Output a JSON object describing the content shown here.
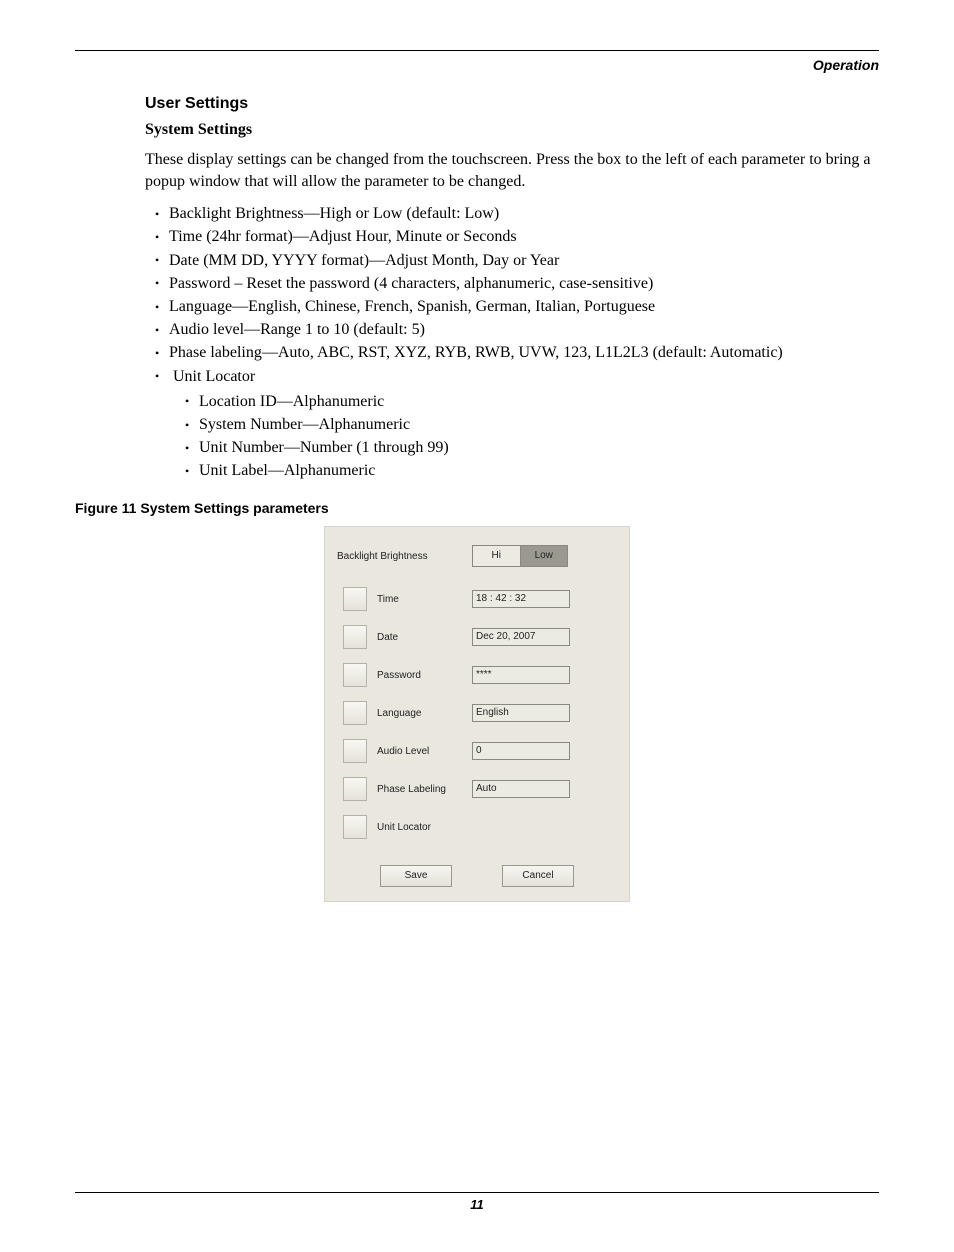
{
  "header": {
    "section": "Operation"
  },
  "headings": {
    "user_settings": "User Settings",
    "system_settings": "System Settings"
  },
  "intro": " These display settings can be changed from the touchscreen. Press the box to the left of each parameter to bring a popup window that will allow the parameter to be changed.",
  "bullets": [
    "Backlight Brightness—High or Low (default: Low)",
    "Time (24hr format)—Adjust Hour, Minute or Seconds",
    "Date (MM DD, YYYY format)—Adjust Month, Day or Year",
    "Password – Reset the password (4 characters, alphanumeric, case-sensitive)",
    "Language—English, Chinese, French, Spanish, German, Italian, Portuguese",
    "Audio level—Range 1 to 10 (default: 5)",
    "Phase labeling—Auto, ABC, RST, XYZ, RYB, RWB, UVW, 123, L1L2L3 (default: Automatic)",
    "Unit Locator"
  ],
  "sub_bullets": [
    "Location ID—Alphanumeric",
    "System Number—Alphanumeric",
    "Unit Number—Number (1 through 99)",
    "Unit Label—Alphanumeric"
  ],
  "figure_caption": "Figure 11    System Settings parameters",
  "panel": {
    "backlight_label": "Backlight Brightness",
    "hi": "Hi",
    "low": "Low",
    "rows": {
      "time": {
        "label": "Time",
        "value": "18 : 42 : 32"
      },
      "date": {
        "label": "Date",
        "value": "Dec 20, 2007"
      },
      "password": {
        "label": "Password",
        "value": "****"
      },
      "language": {
        "label": "Language",
        "value": "English"
      },
      "audio": {
        "label": "Audio Level",
        "value": "0"
      },
      "phase": {
        "label": "Phase Labeling",
        "value": "Auto"
      },
      "locator": {
        "label": "Unit Locator",
        "value": ""
      }
    },
    "save": "Save",
    "cancel": "Cancel"
  },
  "footer": {
    "page": "11"
  }
}
